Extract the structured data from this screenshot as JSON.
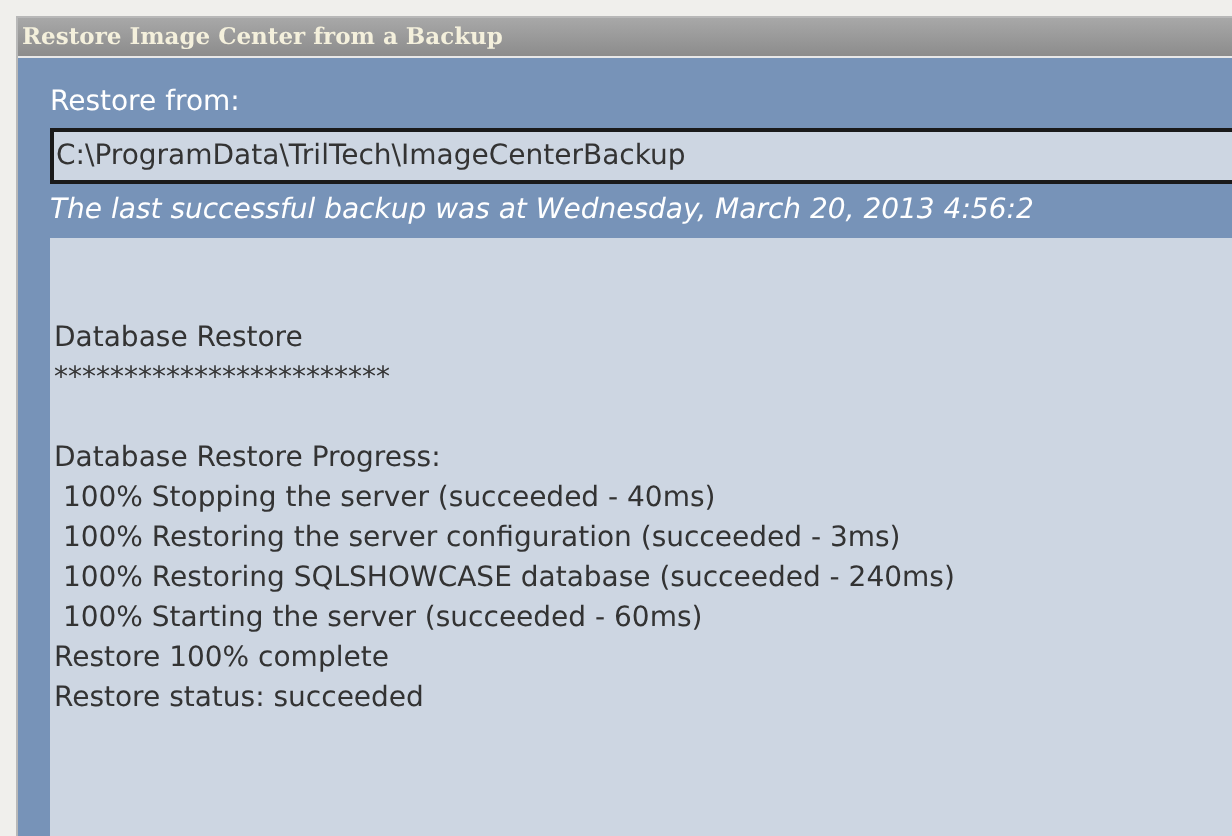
{
  "window": {
    "title": "Restore Image Center from a Backup"
  },
  "restore_from": {
    "label": "Restore from:",
    "value": "C:\\ProgramData\\TrilTech\\ImageCenterBackup"
  },
  "last_backup_note": "The last successful backup was at Wednesday, March 20, 2013 4:56:2",
  "log": {
    "blocks": [
      [
        "Database Restore",
        "************************"
      ],
      [
        "Database Restore Progress:",
        " 100% Stopping the server (succeeded - 40ms)",
        " 100% Restoring the server configuration (succeeded - 3ms)",
        " 100% Restoring SQLSHOWCASE database (succeeded - 240ms)",
        " 100% Starting the server (succeeded - 60ms)",
        "Restore 100% complete",
        "Restore status: succeeded"
      ]
    ]
  }
}
